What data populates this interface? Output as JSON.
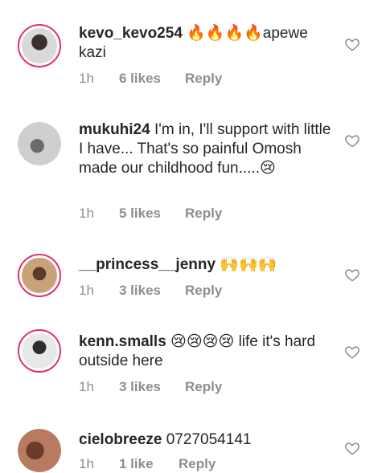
{
  "comments": [
    {
      "username": "kevo_kevo254",
      "text": " 🔥🔥🔥🔥apewe kazi",
      "time": "1h",
      "likes": "6 likes",
      "reply": "Reply"
    },
    {
      "username": "mukuhi24",
      "text": " I'm in, I'll support with little I have... That's so painful Omosh made our childhood fun.....😢",
      "time": "1h",
      "likes": "5 likes",
      "reply": "Reply"
    },
    {
      "username": "__princess__jenny",
      "text": " 🙌🙌🙌",
      "time": "1h",
      "likes": "3 likes",
      "reply": "Reply"
    },
    {
      "username": "kenn.smalls",
      "text": " 😢😢😢😢 life it's hard outside here",
      "time": "1h",
      "likes": "3 likes",
      "reply": "Reply"
    },
    {
      "username": "cielobreeze",
      "text": " 0727054141",
      "time": "1h",
      "likes": "1 like",
      "reply": "Reply"
    }
  ],
  "colors": {
    "ring": "#e1306c",
    "meta": "#8e8e8e",
    "text": "#262626"
  }
}
